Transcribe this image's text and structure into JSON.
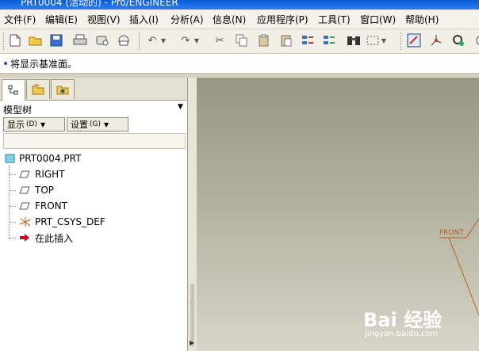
{
  "window": {
    "title": "PRT0004 (活动的) - Pro/ENGINEER"
  },
  "menu": [
    "文件(F)",
    "编辑(E)",
    "视图(V)",
    "插入(I)",
    "分析(A)",
    "信息(N)",
    "应用程序(P)",
    "工具(T)",
    "窗口(W)",
    "帮助(H)"
  ],
  "toolbar": {
    "icons": [
      "new-icon",
      "open-icon",
      "save-icon",
      "print-icon",
      "send-icon",
      "email-icon",
      "undo-icon",
      "redo-icon",
      "cut-icon",
      "copy-icon",
      "paste-icon",
      "paste-special-icon",
      "regenerate-icon",
      "regenerate-manager-icon",
      "find-icon",
      "select-box-icon",
      "sketch-view-icon",
      "datum-axis-icon",
      "settings-icon",
      "spin-icon"
    ]
  },
  "message": {
    "text": "将显示基准面。"
  },
  "model_tree": {
    "header": "模型树",
    "show_button": "显示",
    "show_key": "(D)",
    "settings_button": "设置",
    "settings_key": "(G)",
    "root": "PRT0004.PRT",
    "items": [
      {
        "label": "RIGHT",
        "icon": "datum-plane-icon"
      },
      {
        "label": "TOP",
        "icon": "datum-plane-icon"
      },
      {
        "label": "FRONT",
        "icon": "datum-plane-icon"
      },
      {
        "label": "PRT_CSYS_DEF",
        "icon": "coordinate-system-icon"
      },
      {
        "label": "在此插入",
        "icon": "insert-here-arrow-icon"
      }
    ]
  },
  "viewport": {
    "datum_label": "FRONT",
    "datum_color": "#b5601e"
  },
  "watermark": {
    "logo": "Bai 经验",
    "url": "jingyan.baidu.com"
  }
}
